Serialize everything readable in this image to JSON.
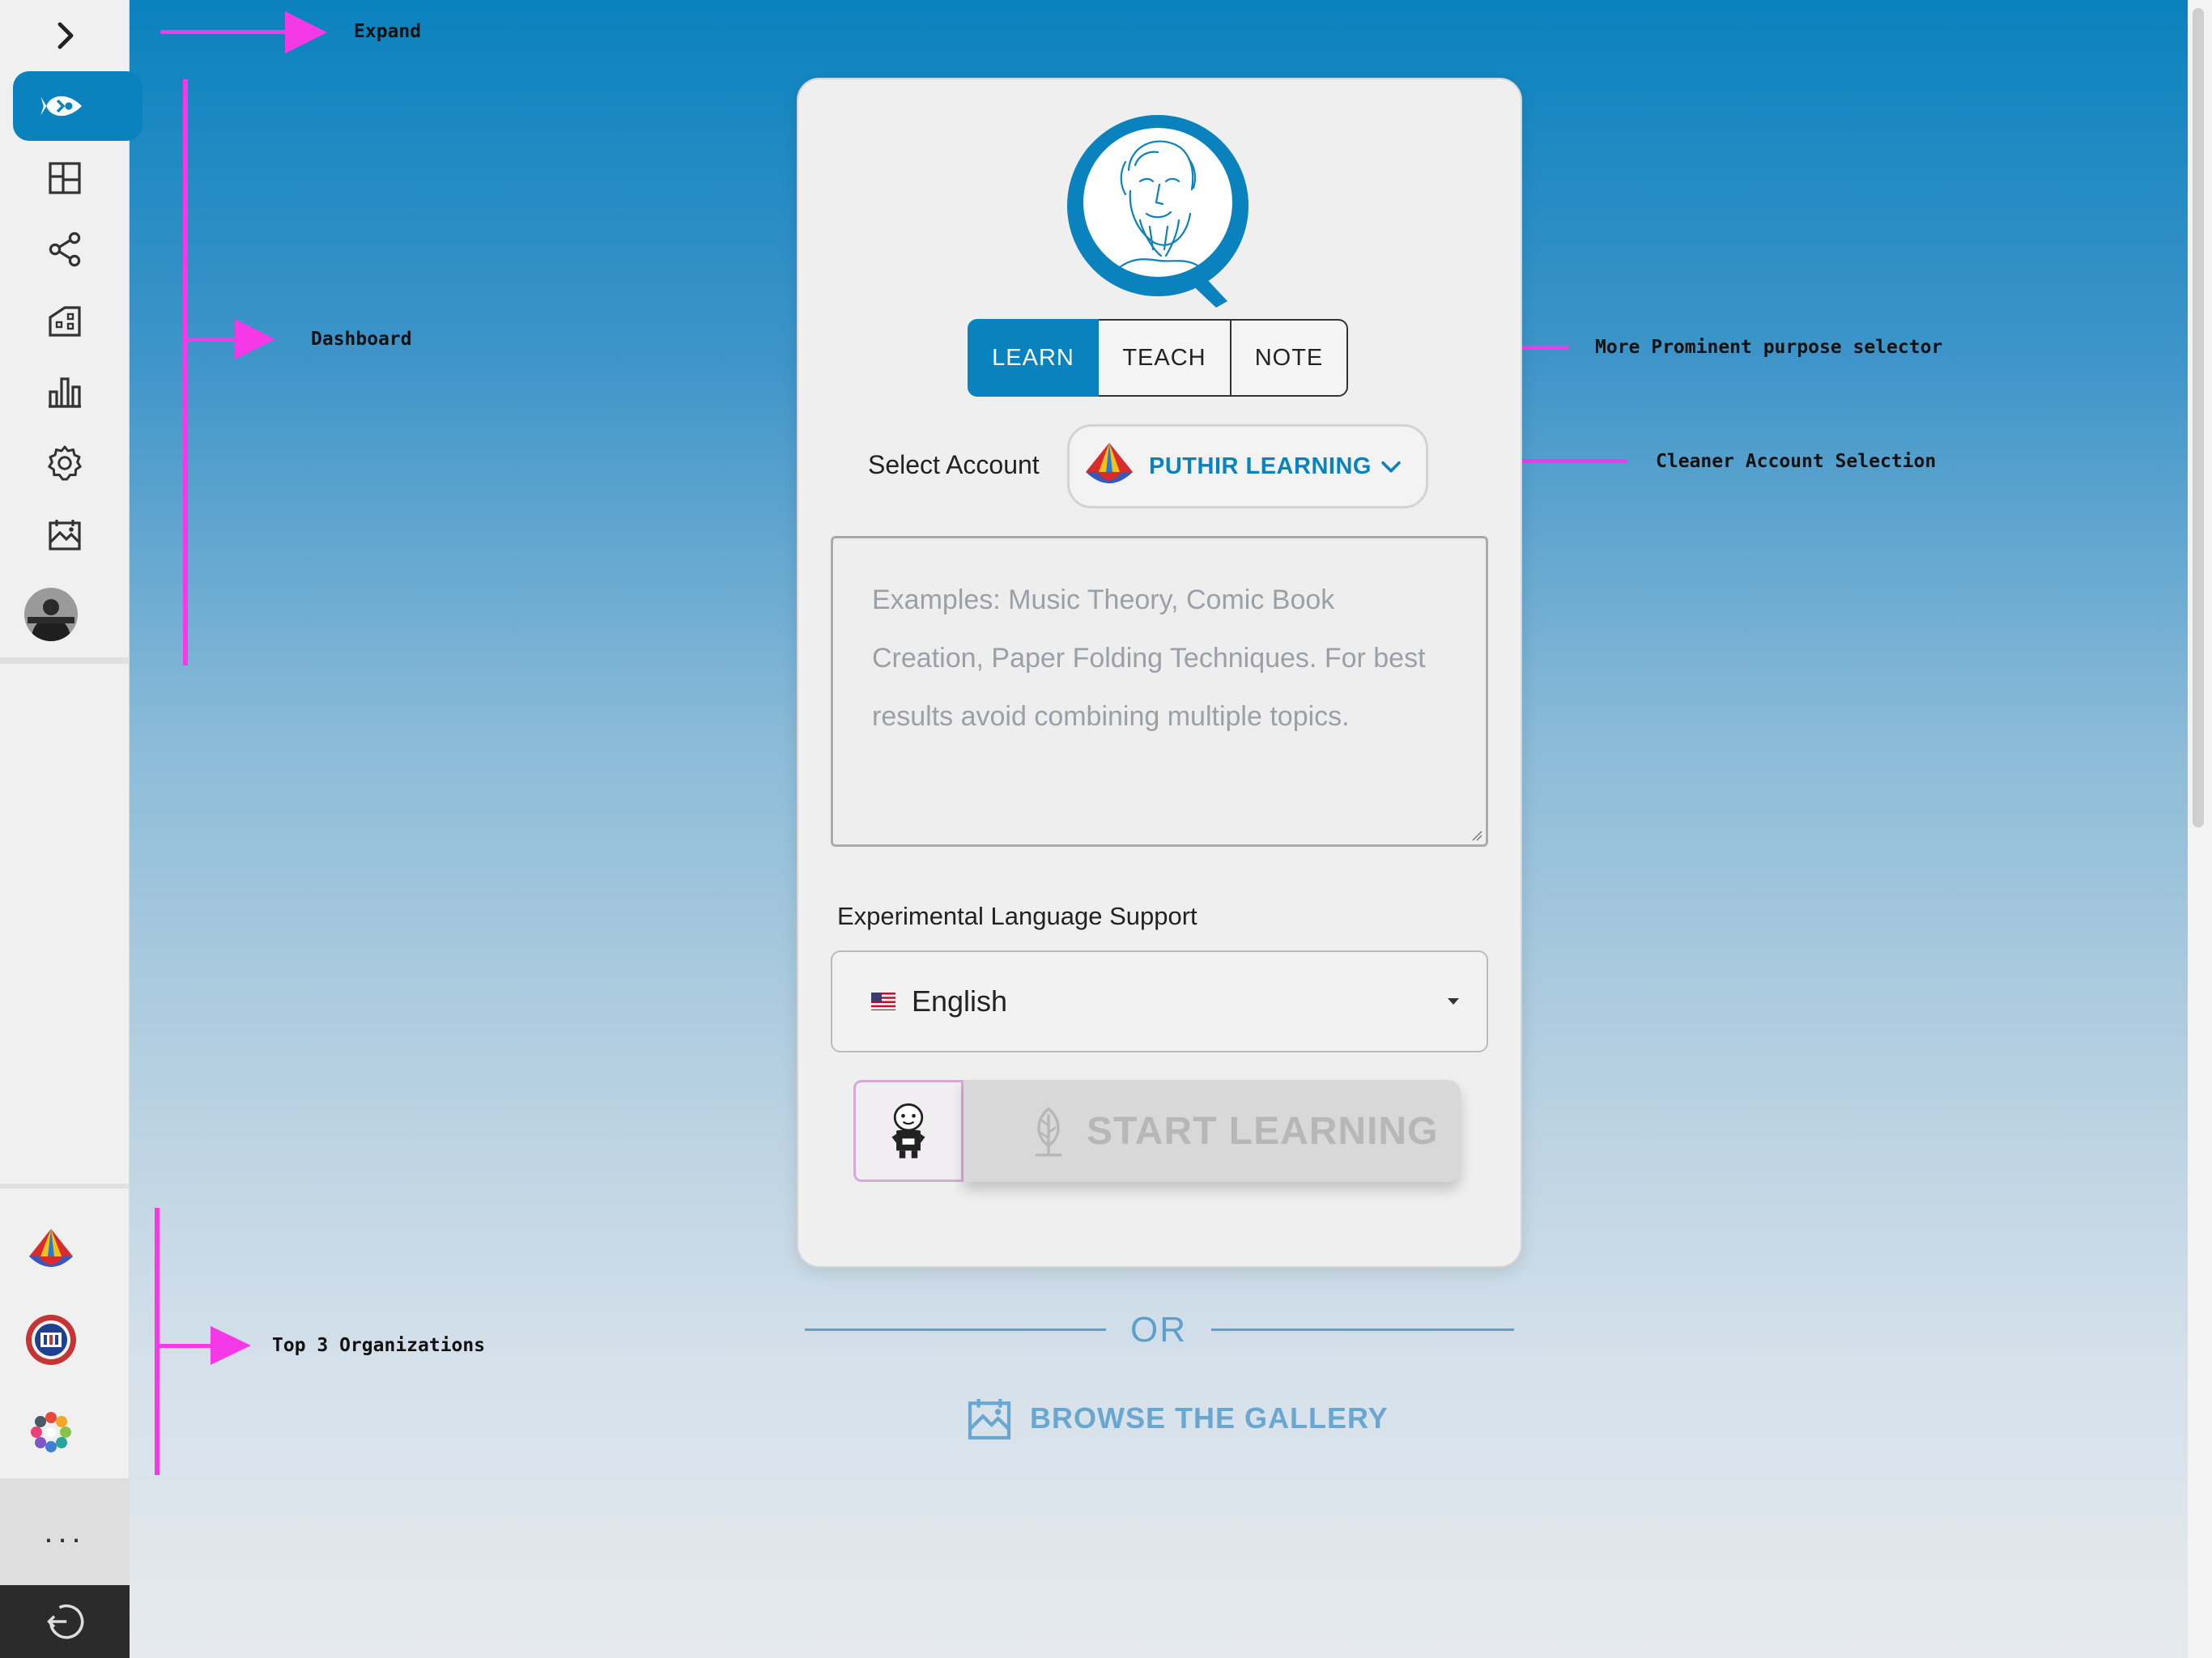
{
  "sidebar": {
    "expand_tooltip": "Expand",
    "nav_icons": [
      "rocket-fish-icon",
      "dashboard-layout-icon",
      "share-icon",
      "building-icon",
      "bar-chart-icon",
      "gear-icon",
      "gallery-icon"
    ],
    "more_label": "...",
    "organizations": [
      "puthir-learning-org",
      "jfr-org",
      "colorful-ring-org"
    ]
  },
  "annotations": {
    "expand": "Expand",
    "dashboard": "Dashboard",
    "purpose_selector": "More Prominent purpose selector",
    "account_selection": "Cleaner Account Selection",
    "top_orgs": "Top 3 Organizations"
  },
  "purpose": {
    "tabs": [
      "LEARN",
      "TEACH",
      "NOTE"
    ],
    "selected": "LEARN"
  },
  "account": {
    "label": "Select Account",
    "name": "PUTHIR LEARNING"
  },
  "topic": {
    "placeholder": "Examples: Music Theory, Comic Book Creation, Paper Folding Techniques. For best results avoid combining multiple topics."
  },
  "language": {
    "label": "Experimental Language Support",
    "selected": "English"
  },
  "start": {
    "label": "START LEARNING"
  },
  "divider": {
    "label": "OR"
  },
  "gallery": {
    "label": "BROWSE THE GALLERY"
  },
  "colors": {
    "brand_blue": "#0a82be",
    "annotation_magenta": "#f539e6"
  }
}
